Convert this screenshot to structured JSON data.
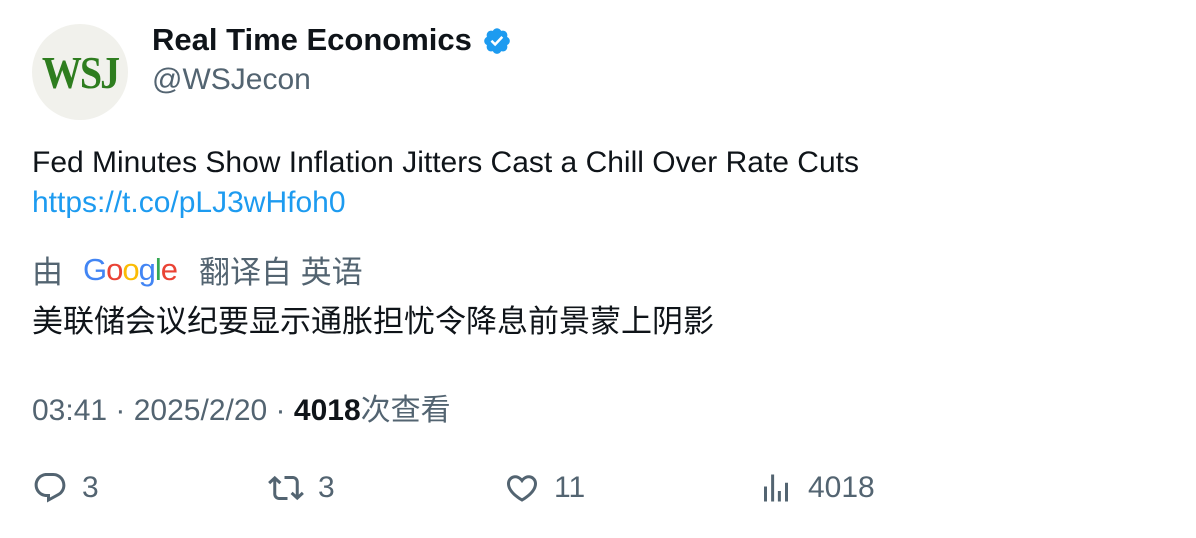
{
  "author": {
    "avatar_text": "WSJ",
    "display_name": "Real Time Economics",
    "handle": "@WSJecon",
    "verified_icon": "verified-badge-icon",
    "verified_color": "#1d9bf0"
  },
  "tweet": {
    "text": "Fed Minutes Show Inflation Jitters Cast a Chill Over Rate Cuts",
    "link": "https://t.co/pLJ3wHfoh0",
    "link_color": "#1d9bf0"
  },
  "translation": {
    "prefix": "由",
    "provider": "Google",
    "suffix": "翻译自 英语",
    "text": "美联储会议纪要显示通胀担忧令降息前景蒙上阴影"
  },
  "meta": {
    "time": "03:41",
    "separator": " · ",
    "date": "2025/2/20",
    "views_count": "4018",
    "views_label": "次查看"
  },
  "actions": {
    "replies": {
      "icon": "reply-icon",
      "count": "3"
    },
    "reposts": {
      "icon": "repost-icon",
      "count": "3"
    },
    "likes": {
      "icon": "heart-icon",
      "count": "11"
    },
    "views": {
      "icon": "analytics-icon",
      "count": "4018"
    }
  },
  "colors": {
    "text": "#0f1419",
    "secondary": "#536471",
    "accent": "#1d9bf0",
    "wsj_green": "#2e7d1f"
  }
}
